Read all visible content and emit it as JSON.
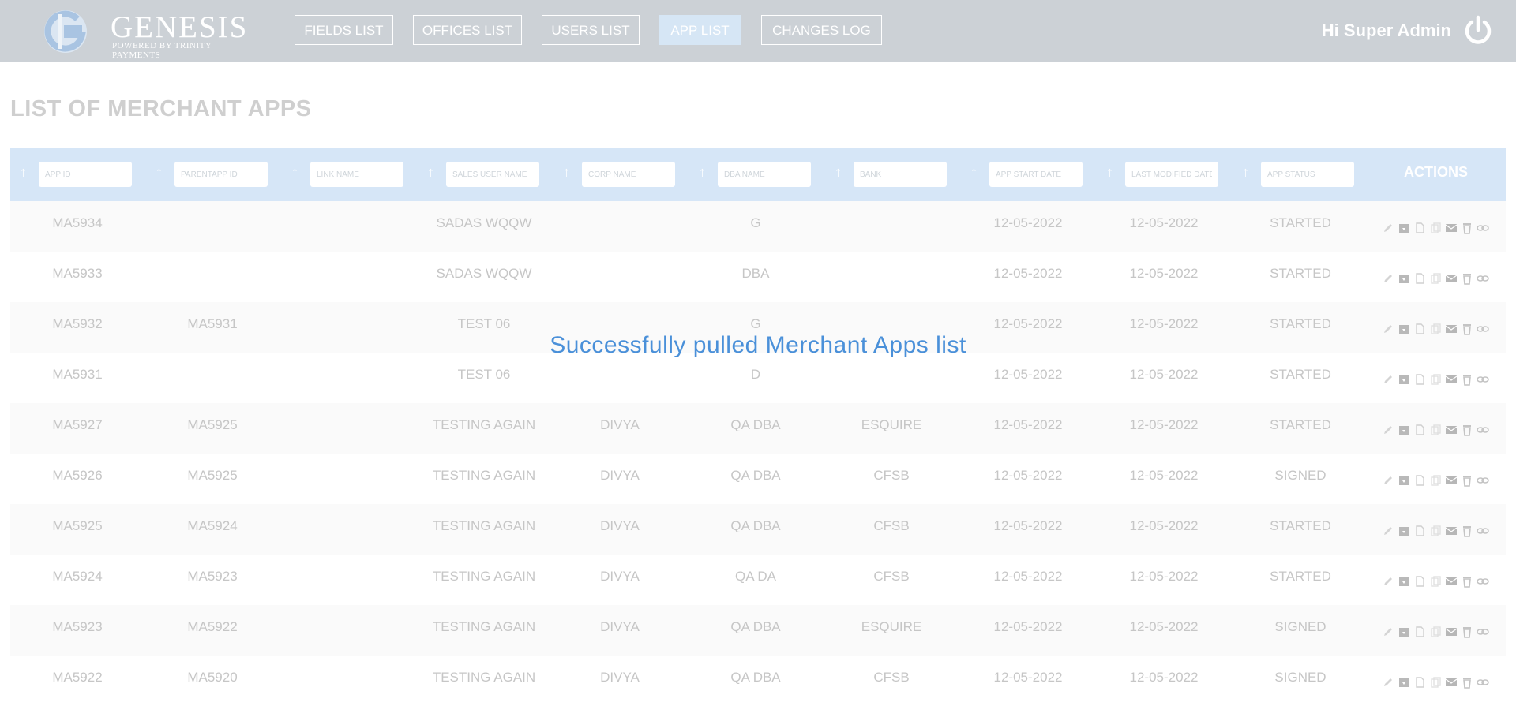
{
  "brand": {
    "name": "GENESIS",
    "tagline": "POWERED BY TRINITY PAYMENTS"
  },
  "nav": [
    {
      "label": "FIELDS LIST",
      "active": false
    },
    {
      "label": "OFFICES LIST",
      "active": false
    },
    {
      "label": "USERS LIST",
      "active": false
    },
    {
      "label": "APP LIST",
      "active": true
    },
    {
      "label": "CHANGES LOG",
      "active": false
    }
  ],
  "user": {
    "greeting": "Hi Super Admin",
    "power_icon": "power-icon"
  },
  "page": {
    "title": "LIST OF MERCHANT APPS"
  },
  "table": {
    "filters": [
      {
        "key": "app_id",
        "placeholder": "APP ID"
      },
      {
        "key": "parent_app_id",
        "placeholder": "PARENTAPP ID"
      },
      {
        "key": "link_name",
        "placeholder": "LINK NAME"
      },
      {
        "key": "sales_user_name",
        "placeholder": "SALES USER NAME"
      },
      {
        "key": "corp_name",
        "placeholder": "CORP NAME"
      },
      {
        "key": "dba_name",
        "placeholder": "DBA NAME"
      },
      {
        "key": "bank",
        "placeholder": "BANK"
      },
      {
        "key": "app_start_date",
        "placeholder": "APP START DATE"
      },
      {
        "key": "last_modified_date",
        "placeholder": "LAST MODIFIED DATE"
      },
      {
        "key": "app_status",
        "placeholder": "APP STATUS"
      }
    ],
    "actions_header": "ACTIONS",
    "action_icons": [
      "edit-icon",
      "archive-icon",
      "document-icon",
      "copy-icon",
      "mail-icon",
      "trash-icon",
      "link-icon"
    ],
    "rows": [
      [
        "MA5934",
        "",
        "",
        "SADAS WQQW",
        "",
        "G",
        "",
        "12-05-2022",
        "12-05-2022",
        "STARTED"
      ],
      [
        "MA5933",
        "",
        "",
        "SADAS WQQW",
        "",
        "DBA",
        "",
        "12-05-2022",
        "12-05-2022",
        "STARTED"
      ],
      [
        "MA5932",
        "MA5931",
        "",
        "TEST 06",
        "",
        "G",
        "",
        "12-05-2022",
        "12-05-2022",
        "STARTED"
      ],
      [
        "MA5931",
        "",
        "",
        "TEST 06",
        "",
        "D",
        "",
        "12-05-2022",
        "12-05-2022",
        "STARTED"
      ],
      [
        "MA5927",
        "MA5925",
        "",
        "TESTING AGAIN",
        "DIVYA",
        "QA DBA",
        "ESQUIRE",
        "12-05-2022",
        "12-05-2022",
        "STARTED"
      ],
      [
        "MA5926",
        "MA5925",
        "",
        "TESTING AGAIN",
        "DIVYA",
        "QA DBA",
        "CFSB",
        "12-05-2022",
        "12-05-2022",
        "SIGNED"
      ],
      [
        "MA5925",
        "MA5924",
        "",
        "TESTING AGAIN",
        "DIVYA",
        "QA DBA",
        "CFSB",
        "12-05-2022",
        "12-05-2022",
        "STARTED"
      ],
      [
        "MA5924",
        "MA5923",
        "",
        "TESTING AGAIN",
        "DIVYA",
        "QA DA",
        "CFSB",
        "12-05-2022",
        "12-05-2022",
        "STARTED"
      ],
      [
        "MA5923",
        "MA5922",
        "",
        "TESTING AGAIN",
        "DIVYA",
        "QA DBA",
        "ESQUIRE",
        "12-05-2022",
        "12-05-2022",
        "SIGNED"
      ],
      [
        "MA5922",
        "MA5920",
        "",
        "TESTING AGAIN",
        "DIVYA",
        "QA DBA",
        "CFSB",
        "12-05-2022",
        "12-05-2022",
        "SIGNED"
      ]
    ]
  },
  "toast": {
    "message": "Successfully pulled Merchant Apps list"
  },
  "colors": {
    "topbar": "#ccd1d6",
    "header_row": "#d6e6f7",
    "accent": "#4a90d9",
    "muted_text": "#c6c6c6"
  }
}
